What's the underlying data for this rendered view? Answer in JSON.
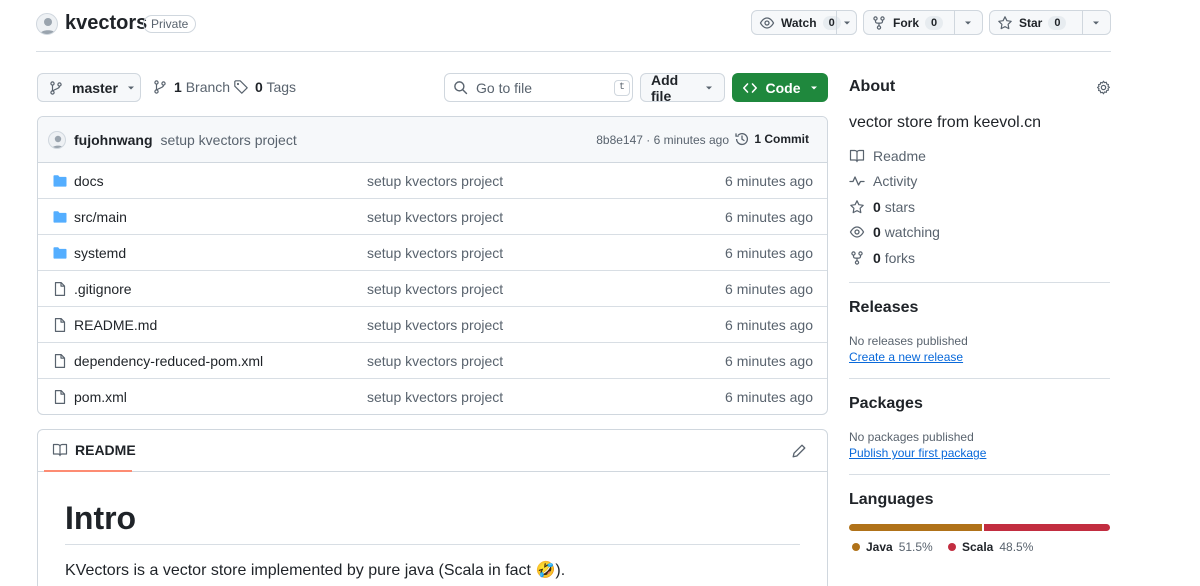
{
  "repo": {
    "name": "kvectors",
    "visibility": "Private"
  },
  "actions": {
    "watch": {
      "label": "Watch",
      "count": "0"
    },
    "fork": {
      "label": "Fork",
      "count": "0"
    },
    "star": {
      "label": "Star",
      "count": "0"
    }
  },
  "toolbar": {
    "branch": "master",
    "branches": {
      "count": "1",
      "label": "Branch"
    },
    "tags": {
      "count": "0",
      "label": "Tags"
    },
    "search_placeholder": "Go to file",
    "search_shortcut": "t",
    "add_file": "Add file",
    "code": "Code"
  },
  "latest_commit": {
    "author": "fujohnwang",
    "message": "setup kvectors project",
    "meta": "8b8e147 · 6 minutes ago",
    "commits": "1 Commit"
  },
  "files": [
    {
      "name": "docs",
      "type": "dir",
      "message": "setup kvectors project",
      "time": "6 minutes ago"
    },
    {
      "name": "src/main",
      "type": "dir",
      "message": "setup kvectors project",
      "time": "6 minutes ago"
    },
    {
      "name": "systemd",
      "type": "dir",
      "message": "setup kvectors project",
      "time": "6 minutes ago"
    },
    {
      "name": ".gitignore",
      "type": "file",
      "message": "setup kvectors project",
      "time": "6 minutes ago"
    },
    {
      "name": "README.md",
      "type": "file",
      "message": "setup kvectors project",
      "time": "6 minutes ago"
    },
    {
      "name": "dependency-reduced-pom.xml",
      "type": "file",
      "message": "setup kvectors project",
      "time": "6 minutes ago"
    },
    {
      "name": "pom.xml",
      "type": "file",
      "message": "setup kvectors project",
      "time": "6 minutes ago"
    }
  ],
  "readme": {
    "tab": "README",
    "heading": "Intro",
    "paragraph": "KVectors is a vector store implemented by pure java (Scala in fact 🤣)."
  },
  "about": {
    "title": "About",
    "description": "vector store from keevol.cn",
    "links": [
      {
        "icon": "book-icon",
        "bold": "",
        "label": "Readme"
      },
      {
        "icon": "pulse-icon",
        "bold": "",
        "label": "Activity"
      },
      {
        "icon": "star-icon",
        "bold": "0",
        "label": "stars"
      },
      {
        "icon": "eye-icon",
        "bold": "0",
        "label": "watching"
      },
      {
        "icon": "fork-icon",
        "bold": "0",
        "label": "forks"
      }
    ]
  },
  "releases": {
    "title": "Releases",
    "empty": "No releases published",
    "action": "Create a new release"
  },
  "packages": {
    "title": "Packages",
    "empty": "No packages published",
    "action": "Publish your first package"
  },
  "languages": {
    "title": "Languages",
    "items": [
      {
        "name": "Java",
        "percent": "51.5%",
        "share": 51.5,
        "color": "#b07219"
      },
      {
        "name": "Scala",
        "percent": "48.5%",
        "share": 48.5,
        "color": "#c22d40"
      }
    ]
  }
}
